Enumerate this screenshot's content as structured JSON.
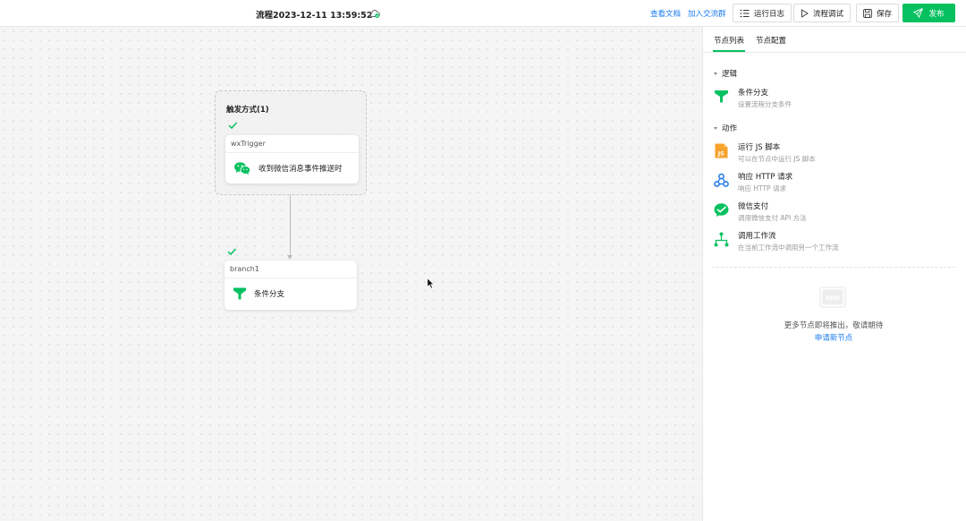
{
  "header": {
    "title": "流程2023-12-11 13:59:52",
    "links": {
      "docs": "查看文档",
      "join_group": "加入交流群"
    },
    "buttons": {
      "run_log": "运行日志",
      "debug": "流程调试",
      "save": "保存",
      "publish": "发布"
    }
  },
  "canvas": {
    "trigger_group": {
      "title": "触发方式(1)",
      "node": {
        "header": "wxTrigger",
        "label": "收到微信消息事件推送时"
      }
    },
    "branch_node": {
      "header": "branch1",
      "label": "条件分支"
    }
  },
  "panel": {
    "tabs": [
      "节点列表",
      "节点配置"
    ],
    "active_tab": "节点列表",
    "sections": [
      {
        "title": "逻辑",
        "items": [
          {
            "label": "条件分支",
            "desc": "设置流程分支条件",
            "icon": "branch-icon"
          }
        ]
      },
      {
        "title": "动作",
        "items": [
          {
            "label": "运行 JS 脚本",
            "desc": "可以在节点中运行 JS 脚本",
            "icon": "js-icon"
          },
          {
            "label": "响应 HTTP 请求",
            "desc": "响应 HTTP 请求",
            "icon": "webhook-icon"
          },
          {
            "label": "微信支付",
            "desc": "调用微信支付 API 方法",
            "icon": "wechat-pay-icon"
          },
          {
            "label": "调用工作流",
            "desc": "在当前工作流中调用另一个工作流",
            "icon": "workflow-icon"
          }
        ]
      }
    ],
    "more": {
      "badge": "NEW",
      "text": "更多节点即将推出，敬请期待",
      "apply_link": "申请新节点"
    }
  },
  "colors": {
    "accent": "#07c160",
    "link": "#1a7cf0",
    "js_orange": "#f7a22d",
    "webhook_blue": "#2b7de9"
  }
}
